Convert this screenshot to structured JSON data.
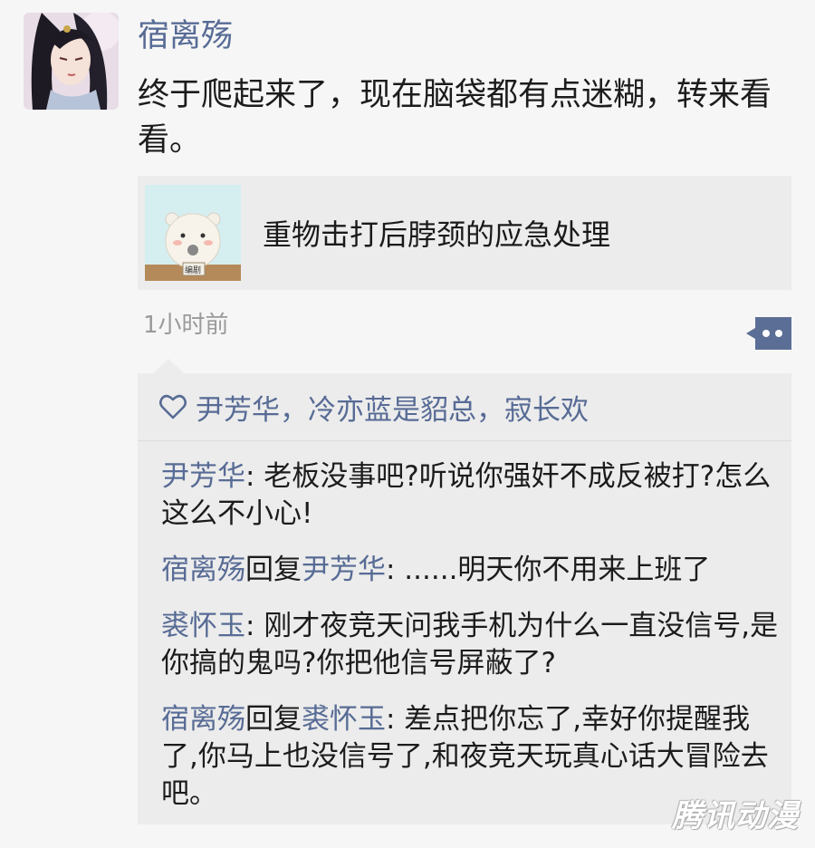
{
  "post": {
    "author": "宿离殇",
    "text": "终于爬起来了，现在脑袋都有点迷糊，转来看看。",
    "time": "1小时前"
  },
  "share_card": {
    "title": "重物击打后脖颈的应急处理",
    "thumb_sign": "编剧",
    "thumb_icon": "bear-reporter-icon"
  },
  "likes": {
    "icon": "heart-icon",
    "text": "尹芳华，冷亦蓝是貂总，寂长欢"
  },
  "comments": [
    {
      "name": "尹芳华",
      "reply_word": "",
      "reply_to": "",
      "text": ": 老板没事吧?听说你强奸不成反被打?怎么这么不小心!"
    },
    {
      "name": "宿离殇",
      "reply_word": "回复",
      "reply_to": "尹芳华",
      "text": ": ......明天你不用来上班了"
    },
    {
      "name": "裘怀玉",
      "reply_word": "",
      "reply_to": "",
      "text": ": 刚才夜竞天问我手机为什么一直没信号,是你搞的鬼吗?你把他信号屏蔽了?"
    },
    {
      "name": "宿离殇",
      "reply_word": "回复",
      "reply_to": "裘怀玉",
      "text": ": 差点把你忘了,幸好你提醒我了,你马上也没信号了,和夜竞天玩真心话大冒险去吧。"
    }
  ],
  "watermark": "腾讯动漫",
  "colors": {
    "link": "#576b95",
    "background": "#f6f6f6",
    "panel": "#ececec"
  }
}
